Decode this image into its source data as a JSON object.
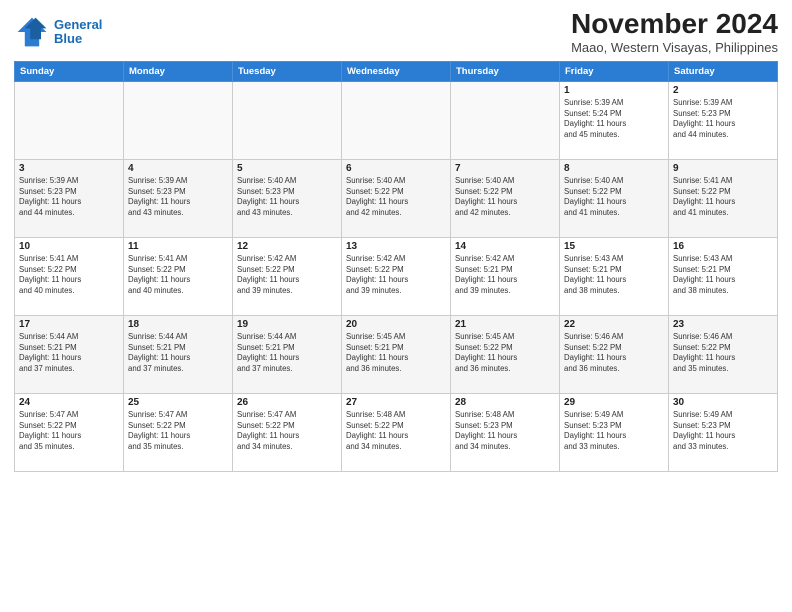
{
  "logo": {
    "line1": "General",
    "line2": "Blue"
  },
  "title": "November 2024",
  "subtitle": "Maao, Western Visayas, Philippines",
  "headers": [
    "Sunday",
    "Monday",
    "Tuesday",
    "Wednesday",
    "Thursday",
    "Friday",
    "Saturday"
  ],
  "weeks": [
    [
      {
        "day": "",
        "info": ""
      },
      {
        "day": "",
        "info": ""
      },
      {
        "day": "",
        "info": ""
      },
      {
        "day": "",
        "info": ""
      },
      {
        "day": "",
        "info": ""
      },
      {
        "day": "1",
        "info": "Sunrise: 5:39 AM\nSunset: 5:24 PM\nDaylight: 11 hours\nand 45 minutes."
      },
      {
        "day": "2",
        "info": "Sunrise: 5:39 AM\nSunset: 5:23 PM\nDaylight: 11 hours\nand 44 minutes."
      }
    ],
    [
      {
        "day": "3",
        "info": "Sunrise: 5:39 AM\nSunset: 5:23 PM\nDaylight: 11 hours\nand 44 minutes."
      },
      {
        "day": "4",
        "info": "Sunrise: 5:39 AM\nSunset: 5:23 PM\nDaylight: 11 hours\nand 43 minutes."
      },
      {
        "day": "5",
        "info": "Sunrise: 5:40 AM\nSunset: 5:23 PM\nDaylight: 11 hours\nand 43 minutes."
      },
      {
        "day": "6",
        "info": "Sunrise: 5:40 AM\nSunset: 5:22 PM\nDaylight: 11 hours\nand 42 minutes."
      },
      {
        "day": "7",
        "info": "Sunrise: 5:40 AM\nSunset: 5:22 PM\nDaylight: 11 hours\nand 42 minutes."
      },
      {
        "day": "8",
        "info": "Sunrise: 5:40 AM\nSunset: 5:22 PM\nDaylight: 11 hours\nand 41 minutes."
      },
      {
        "day": "9",
        "info": "Sunrise: 5:41 AM\nSunset: 5:22 PM\nDaylight: 11 hours\nand 41 minutes."
      }
    ],
    [
      {
        "day": "10",
        "info": "Sunrise: 5:41 AM\nSunset: 5:22 PM\nDaylight: 11 hours\nand 40 minutes."
      },
      {
        "day": "11",
        "info": "Sunrise: 5:41 AM\nSunset: 5:22 PM\nDaylight: 11 hours\nand 40 minutes."
      },
      {
        "day": "12",
        "info": "Sunrise: 5:42 AM\nSunset: 5:22 PM\nDaylight: 11 hours\nand 39 minutes."
      },
      {
        "day": "13",
        "info": "Sunrise: 5:42 AM\nSunset: 5:22 PM\nDaylight: 11 hours\nand 39 minutes."
      },
      {
        "day": "14",
        "info": "Sunrise: 5:42 AM\nSunset: 5:21 PM\nDaylight: 11 hours\nand 39 minutes."
      },
      {
        "day": "15",
        "info": "Sunrise: 5:43 AM\nSunset: 5:21 PM\nDaylight: 11 hours\nand 38 minutes."
      },
      {
        "day": "16",
        "info": "Sunrise: 5:43 AM\nSunset: 5:21 PM\nDaylight: 11 hours\nand 38 minutes."
      }
    ],
    [
      {
        "day": "17",
        "info": "Sunrise: 5:44 AM\nSunset: 5:21 PM\nDaylight: 11 hours\nand 37 minutes."
      },
      {
        "day": "18",
        "info": "Sunrise: 5:44 AM\nSunset: 5:21 PM\nDaylight: 11 hours\nand 37 minutes."
      },
      {
        "day": "19",
        "info": "Sunrise: 5:44 AM\nSunset: 5:21 PM\nDaylight: 11 hours\nand 37 minutes."
      },
      {
        "day": "20",
        "info": "Sunrise: 5:45 AM\nSunset: 5:21 PM\nDaylight: 11 hours\nand 36 minutes."
      },
      {
        "day": "21",
        "info": "Sunrise: 5:45 AM\nSunset: 5:22 PM\nDaylight: 11 hours\nand 36 minutes."
      },
      {
        "day": "22",
        "info": "Sunrise: 5:46 AM\nSunset: 5:22 PM\nDaylight: 11 hours\nand 36 minutes."
      },
      {
        "day": "23",
        "info": "Sunrise: 5:46 AM\nSunset: 5:22 PM\nDaylight: 11 hours\nand 35 minutes."
      }
    ],
    [
      {
        "day": "24",
        "info": "Sunrise: 5:47 AM\nSunset: 5:22 PM\nDaylight: 11 hours\nand 35 minutes."
      },
      {
        "day": "25",
        "info": "Sunrise: 5:47 AM\nSunset: 5:22 PM\nDaylight: 11 hours\nand 35 minutes."
      },
      {
        "day": "26",
        "info": "Sunrise: 5:47 AM\nSunset: 5:22 PM\nDaylight: 11 hours\nand 34 minutes."
      },
      {
        "day": "27",
        "info": "Sunrise: 5:48 AM\nSunset: 5:22 PM\nDaylight: 11 hours\nand 34 minutes."
      },
      {
        "day": "28",
        "info": "Sunrise: 5:48 AM\nSunset: 5:23 PM\nDaylight: 11 hours\nand 34 minutes."
      },
      {
        "day": "29",
        "info": "Sunrise: 5:49 AM\nSunset: 5:23 PM\nDaylight: 11 hours\nand 33 minutes."
      },
      {
        "day": "30",
        "info": "Sunrise: 5:49 AM\nSunset: 5:23 PM\nDaylight: 11 hours\nand 33 minutes."
      }
    ]
  ]
}
